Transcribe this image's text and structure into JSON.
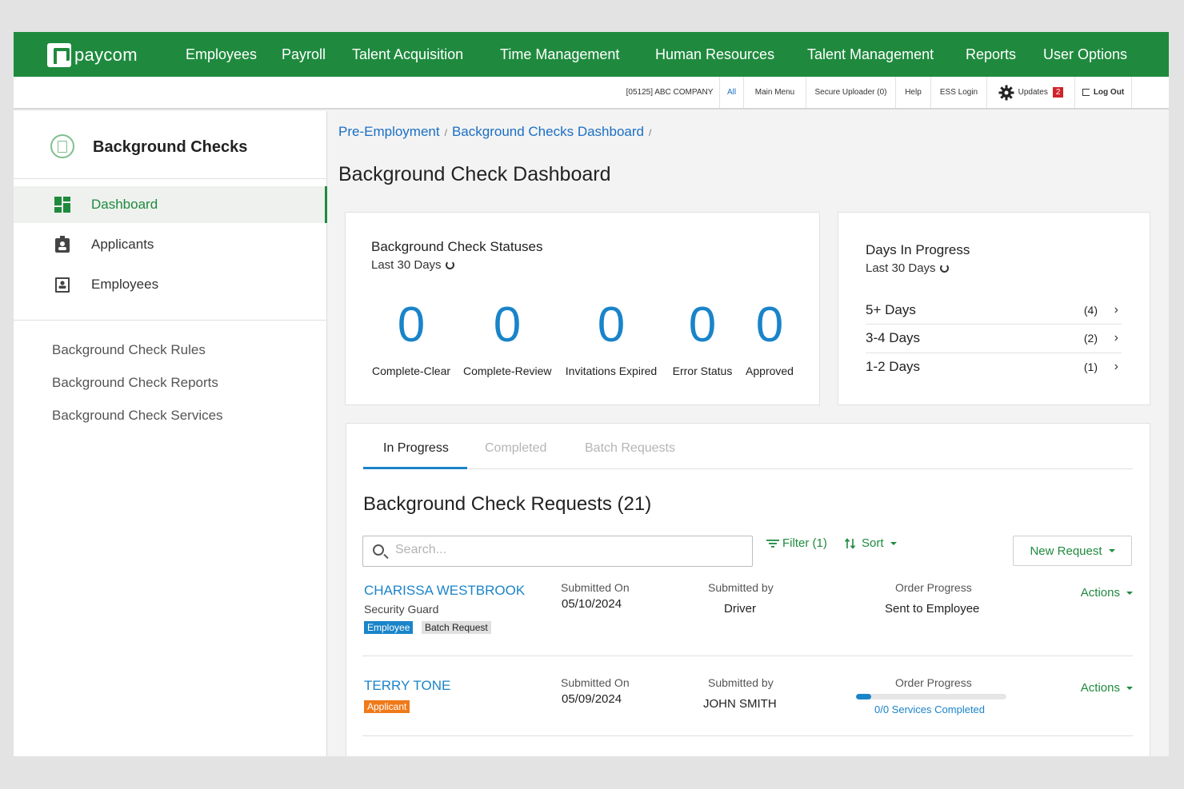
{
  "brand": {
    "name": "paycom",
    "green": "#1f8a3e",
    "blue": "#1a84c9"
  },
  "topnav": [
    "Employees",
    "Payroll",
    "Talent Acquisition",
    "Time Management",
    "Human Resources",
    "Talent Management",
    "Reports",
    "User Options"
  ],
  "utilbar": {
    "company": "[05125] ABC COMPANY",
    "all": "All",
    "main_menu": "Main Menu",
    "secure_uploader": "Secure Uploader (0)",
    "help": "Help",
    "ess_login": "ESS Login",
    "updates": "Updates",
    "updates_count": "2",
    "logout": "Log Out"
  },
  "sidebar": {
    "title": "Background Checks",
    "nav": [
      {
        "label": "Dashboard",
        "icon": "dashboard-icon",
        "active": true
      },
      {
        "label": "Applicants",
        "icon": "applicant-badge-icon",
        "active": false
      },
      {
        "label": "Employees",
        "icon": "employee-badge-icon",
        "active": false
      }
    ],
    "links": [
      "Background Check Rules",
      "Background Check Reports",
      "Background Check Services"
    ]
  },
  "breadcrumb": [
    "Pre-Employment",
    "Background Checks Dashboard"
  ],
  "page_title": "Background Check Dashboard",
  "statuses": {
    "title": "Background Check Statuses",
    "subtitle": "Last 30 Days",
    "items": [
      {
        "value": "0",
        "label": "Complete-Clear"
      },
      {
        "value": "0",
        "label": "Complete-Review"
      },
      {
        "value": "0",
        "label": "Invitations Expired"
      },
      {
        "value": "0",
        "label": "Error Status"
      },
      {
        "value": "0",
        "label": "Approved"
      }
    ]
  },
  "days": {
    "title": "Days In Progress",
    "subtitle": "Last 30 Days",
    "rows": [
      {
        "label": "5+ Days",
        "count": "(4)"
      },
      {
        "label": "3-4 Days",
        "count": "(2)"
      },
      {
        "label": "1-2 Days",
        "count": "(1)"
      }
    ]
  },
  "tabs": [
    "In Progress",
    "Completed",
    "Batch Requests"
  ],
  "requests": {
    "title": "Background Check Requests (21)",
    "search_placeholder": "Search...",
    "filter": "Filter (1)",
    "sort": "Sort",
    "new_request": "New Request",
    "col_submitted_on": "Submitted On",
    "col_submitted_by": "Submitted by",
    "col_progress": "Order Progress",
    "actions": "Actions",
    "rows": [
      {
        "name": "CHARISSA WESTBROOK",
        "job": "Security Guard",
        "tags": [
          "Employee",
          "Batch Request"
        ],
        "submitted_on": "05/10/2024",
        "submitted_by": "Driver",
        "progress_text": "Sent to Employee"
      },
      {
        "name": "TERRY TONE",
        "job": "",
        "tags": [
          "Applicant"
        ],
        "submitted_on": "05/09/2024",
        "submitted_by": "JOHN SMITH",
        "progress_fraction": 0.1,
        "services": "0/0 Services Completed"
      }
    ]
  }
}
